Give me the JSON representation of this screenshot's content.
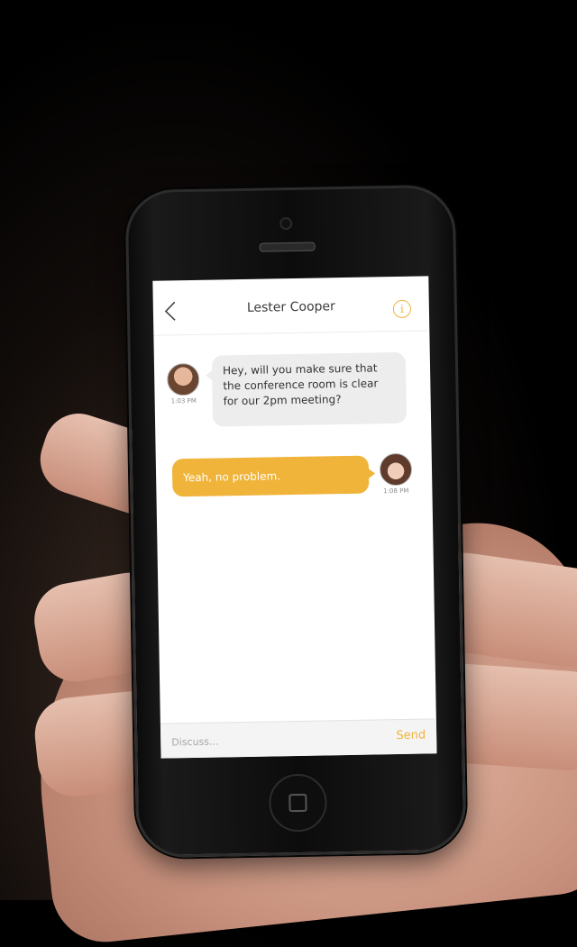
{
  "conversation": {
    "contact_name": "Lester Cooper"
  },
  "messages": [
    {
      "direction": "incoming",
      "text": "Hey, will you make sure that the conference room is clear for our 2pm meeting?",
      "time": "1:03 PM"
    },
    {
      "direction": "outgoing",
      "text": "Yeah, no problem.",
      "time": "1:08 PM"
    }
  ],
  "composer": {
    "placeholder": "Discuss...",
    "value": "",
    "send_label": "Send"
  },
  "theme": {
    "accent": "#f0b43a",
    "incoming_bubble": "#ededed",
    "background": "#ffffff"
  },
  "icons": {
    "back": "chevron-left-icon",
    "info": "info-circle-icon"
  }
}
